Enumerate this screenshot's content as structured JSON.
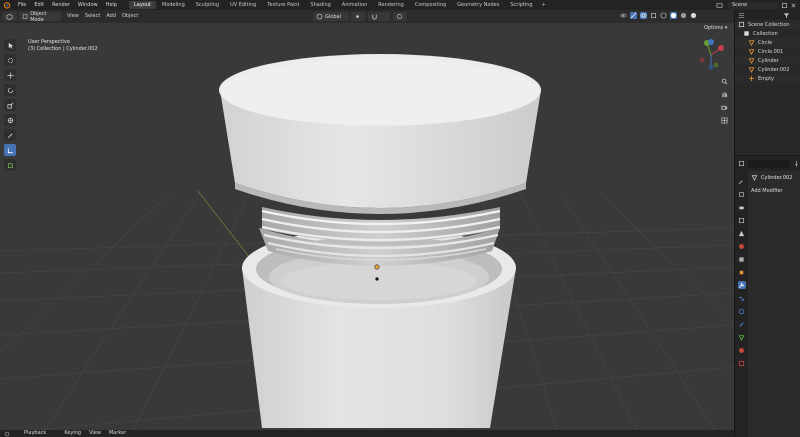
{
  "menubar": {
    "items": [
      "File",
      "Edit",
      "Render",
      "Window",
      "Help"
    ],
    "workspaces": [
      "Layout",
      "Modeling",
      "Sculpting",
      "UV Editing",
      "Texture Paint",
      "Shading",
      "Animation",
      "Rendering",
      "Compositing",
      "Geometry Nodes",
      "Scripting"
    ],
    "active_workspace": "Layout",
    "add_tab": "+",
    "scene": "Scene"
  },
  "viewport_header": {
    "mode": "Object Mode",
    "menus": [
      "View",
      "Select",
      "Add",
      "Object"
    ],
    "orientation": "Global"
  },
  "viewport": {
    "perspective": "User Perspective",
    "collection_info": "(3) Collection | Cylinder.002",
    "options_label": "Options"
  },
  "outliner": {
    "rows": [
      {
        "label": "Scene Collection",
        "icon": "scene-collection-icon",
        "indent": 0
      },
      {
        "label": "Collection",
        "icon": "collection-icon",
        "indent": 1
      },
      {
        "label": "Circle",
        "icon": "mesh-icon",
        "indent": 2
      },
      {
        "label": "Circle.001",
        "icon": "mesh-icon",
        "indent": 2
      },
      {
        "label": "Cylinder",
        "icon": "mesh-icon",
        "indent": 2
      },
      {
        "label": "Cylinder.002",
        "icon": "mesh-icon",
        "indent": 2
      },
      {
        "label": "Empty",
        "icon": "empty-icon",
        "indent": 2
      }
    ]
  },
  "properties": {
    "object_name": "Cylinder.002",
    "add_modifier": "Add Modifier"
  },
  "timeline": {
    "items": [
      "Playback",
      "Keying",
      "View",
      "Marker"
    ]
  },
  "colors": {
    "accent": "#4772b3",
    "viewport_bg": "#383838",
    "mesh_light": "#e2e2e2",
    "selection_orange": "#e8a236"
  }
}
